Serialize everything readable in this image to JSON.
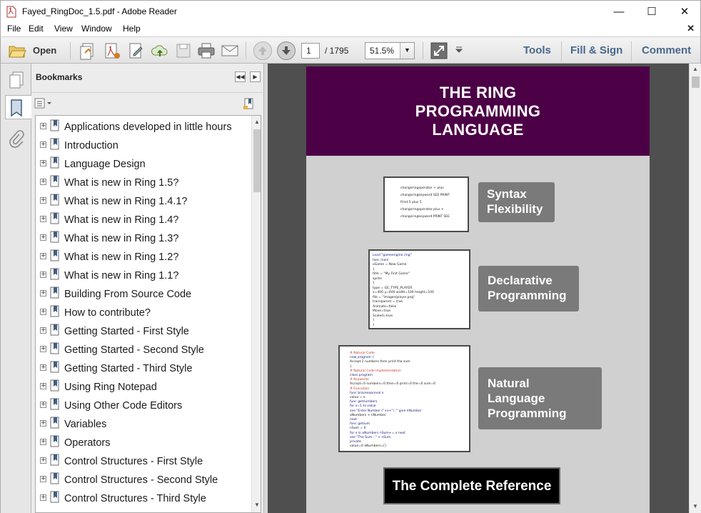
{
  "window": {
    "title": "Fayed_RingDoc_1.5.pdf - Adobe Reader",
    "minimize": "—",
    "maximize": "☐",
    "close": "✕"
  },
  "menu": {
    "items": [
      "File",
      "Edit",
      "View",
      "Window",
      "Help"
    ],
    "doc_close": "✕"
  },
  "toolbar": {
    "open_label": "Open",
    "page_current": "1",
    "page_total": "/ 1795",
    "zoom": "51.5%",
    "zoom_arrow": "▼",
    "tools": "Tools",
    "fill_sign": "Fill & Sign",
    "comment": "Comment"
  },
  "bookmarks": {
    "title": "Bookmarks",
    "collapse": "◀◀",
    "expand": "▶",
    "items": [
      "Applications developed in little hours",
      "Introduction",
      "Language Design",
      "What is new in Ring 1.5?",
      "What is new in Ring 1.4.1?",
      "What is new in Ring 1.4?",
      "What is new in Ring 1.3?",
      "What is new in Ring 1.2?",
      "What is new in Ring 1.1?",
      "Building From Source Code",
      "How to contribute?",
      "Getting Started - First Style",
      "Getting Started - Second Style",
      "Getting Started - Third Style",
      "Using Ring Notepad",
      "Using Other Code Editors",
      "Variables",
      "Operators",
      "Control Structures - First Style",
      "Control Structures - Second Style",
      "Control Structures - Third Style"
    ]
  },
  "cover": {
    "title_lines": [
      "THE RING",
      "PROGRAMMING",
      "LANGUAGE"
    ],
    "banner_color": "#4c0046",
    "features": [
      {
        "lines": [
          "Syntax",
          "Flexibility"
        ]
      },
      {
        "lines": [
          "Declarative",
          "Programming"
        ]
      },
      {
        "lines": [
          "Natural",
          "Language",
          "Programming"
        ]
      }
    ],
    "reference": "The Complete Reference",
    "code1": [
      "changeringoperator + plus",
      "changeringkeyword SEE PRINT",
      "Print 5 plus 5",
      "changeringoperator plus +",
      "changeringkeyword PRINT SEE"
    ],
    "code2": [
      "Load \"gameengine.ring\"",
      "func main",
      "oGame = New Game",
      "{",
      "title = \"My First Game\"",
      "sprite",
      "{",
      "type = GE_TYPE_PLAYER",
      "x=400 y=400 width=100 height=100",
      "file = \"images/player.png\"",
      "transparent = true",
      "Animate=false",
      "Move=true",
      "Scaled=true",
      "}",
      "}"
    ],
    "code3": [
      "# Natural Code",
      "new program {",
      "Accept 2 numbers then print the sum",
      "}",
      "# Natural Code Implementation",
      "class program",
      "# Keywords",
      "Accept=0 numbers=0 then=0 print=0 the=0 sum=0",
      "# Execution",
      "func braceexpreval x",
      "value = x",
      "func getnumbers",
      "for x=1 to value",
      "see \"Enter Number (\"+x+\") :\" give nNumber",
      "aNumbers + nNumber",
      "next",
      "func getsum",
      "nSum = 0",
      "for x in aNumbers nSum+= x next",
      "see \"The Sum : \" + nSum",
      "private",
      "value=0 aNumbers=[]"
    ]
  }
}
